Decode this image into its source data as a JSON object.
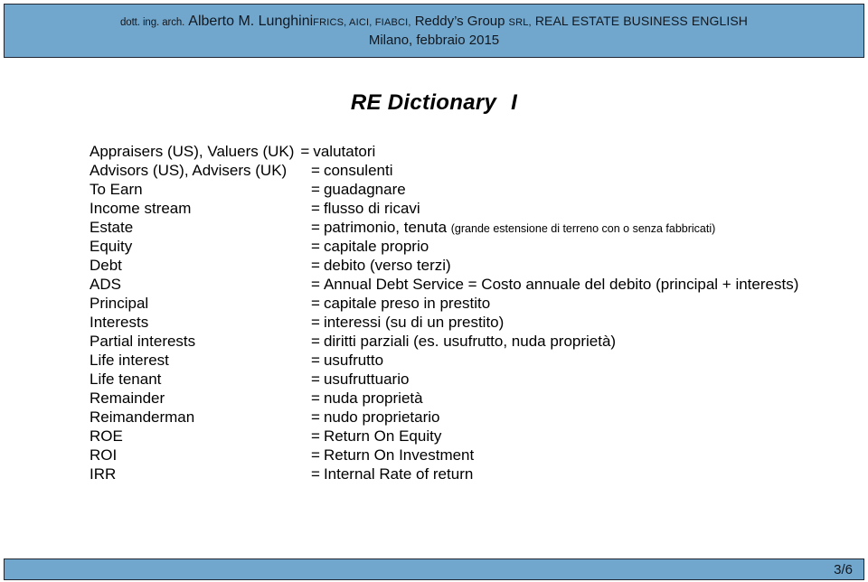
{
  "header": {
    "line1": {
      "prefix": "dott. ing. arch.",
      "name": "Alberto M. Lunghini",
      "credentials": "FRICS, AICI, FIABCI,",
      "company": "Reddy’s Group",
      "company_suffix": "SRL,",
      "course": "REAL ESTATE BUSINESS ENGLISH"
    },
    "line2": "Milano, febbraio 2015",
    "band_color": "#72a7cd"
  },
  "title": {
    "main": "RE Dictionary",
    "numeral": "I"
  },
  "glossary": {
    "equals": "=",
    "entries": [
      {
        "term": "Appraisers (US), Valuers (UK)",
        "definition": "valutatori",
        "note": "",
        "wide": true
      },
      {
        "term": "Advisors (US), Advisers (UK)",
        "definition": "consulenti",
        "note": "",
        "wide": false
      },
      {
        "term": "To Earn",
        "definition": "guadagnare",
        "note": "",
        "wide": false
      },
      {
        "term": "Income stream",
        "definition": "flusso di ricavi",
        "note": "",
        "wide": false
      },
      {
        "term": "Estate",
        "definition": "patrimonio, tenuta",
        "note": "(grande estensione di terreno con o senza fabbricati)",
        "wide": false
      },
      {
        "term": "Equity",
        "definition": "capitale proprio",
        "note": "",
        "wide": false
      },
      {
        "term": "Debt",
        "definition": "debito (verso terzi)",
        "note": "",
        "wide": false
      },
      {
        "term": "ADS",
        "definition": "Annual Debt Service = Costo annuale del debito (principal + interests)",
        "note": "",
        "wide": false
      },
      {
        "term": "Principal",
        "definition": "capitale preso in prestito",
        "note": "",
        "wide": false
      },
      {
        "term": "Interests",
        "definition": "interessi (su di un prestito)",
        "note": "",
        "wide": false
      },
      {
        "term": "Partial interests",
        "definition": "diritti parziali (es. usufrutto, nuda proprietà)",
        "note": "",
        "wide": false
      },
      {
        "term": "Life interest",
        "definition": "usufrutto",
        "note": "",
        "wide": false
      },
      {
        "term": "Life tenant",
        "definition": "usufruttuario",
        "note": "",
        "wide": false
      },
      {
        "term": "Remainder",
        "definition": "nuda proprietà",
        "note": "",
        "wide": false
      },
      {
        "term": "Reimanderman",
        "definition": "nudo proprietario",
        "note": "",
        "wide": false
      },
      {
        "term": "ROE",
        "definition": "Return On Equity",
        "note": "",
        "wide": false
      },
      {
        "term": "ROI",
        "definition": "Return On Investment",
        "note": "",
        "wide": false
      },
      {
        "term": "IRR",
        "definition": "Internal Rate of return",
        "note": "",
        "wide": false
      }
    ]
  },
  "footer": {
    "page_number": "3/6",
    "band_color": "#72a7cd"
  }
}
